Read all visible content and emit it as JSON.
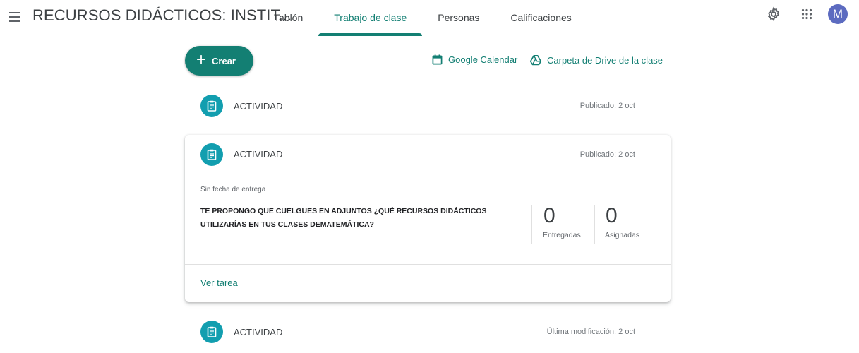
{
  "header": {
    "menu_icon": "hamburger-menu-icon",
    "class_title": "RECURSOS DIDÁCTICOS: INSTIT...",
    "tabs": [
      {
        "label": "Tablón",
        "active": false
      },
      {
        "label": "Trabajo de clase",
        "active": true
      },
      {
        "label": "Personas",
        "active": false
      },
      {
        "label": "Calificaciones",
        "active": false
      }
    ],
    "avatar_initial": "M",
    "accent_color": "#137f73"
  },
  "toolbar": {
    "create_label": "Crear",
    "calendar_label": "Google Calendar",
    "drive_label": "Carpeta de Drive de la clase"
  },
  "assignments": [
    {
      "title": "ACTIVIDAD",
      "date": "Publicado: 2 oct"
    },
    {
      "title": "ACTIVIDAD",
      "date": "Publicado: 2 oct",
      "due": "Sin fecha de entrega",
      "description": "TE PROPONGO QUE CUELGUES EN ADJUNTOS ¿QUÉ RECURSOS DIDÁCTICOS UTILIZARÍAS EN TUS CLASES DEMATEMÁTICA?",
      "turned_in_count": "0",
      "turned_in_label": "Entregadas",
      "assigned_count": "0",
      "assigned_label": "Asignadas",
      "view_label": "Ver tarea"
    },
    {
      "title": "ACTIVIDAD",
      "date": "Última modificación: 2 oct"
    }
  ]
}
